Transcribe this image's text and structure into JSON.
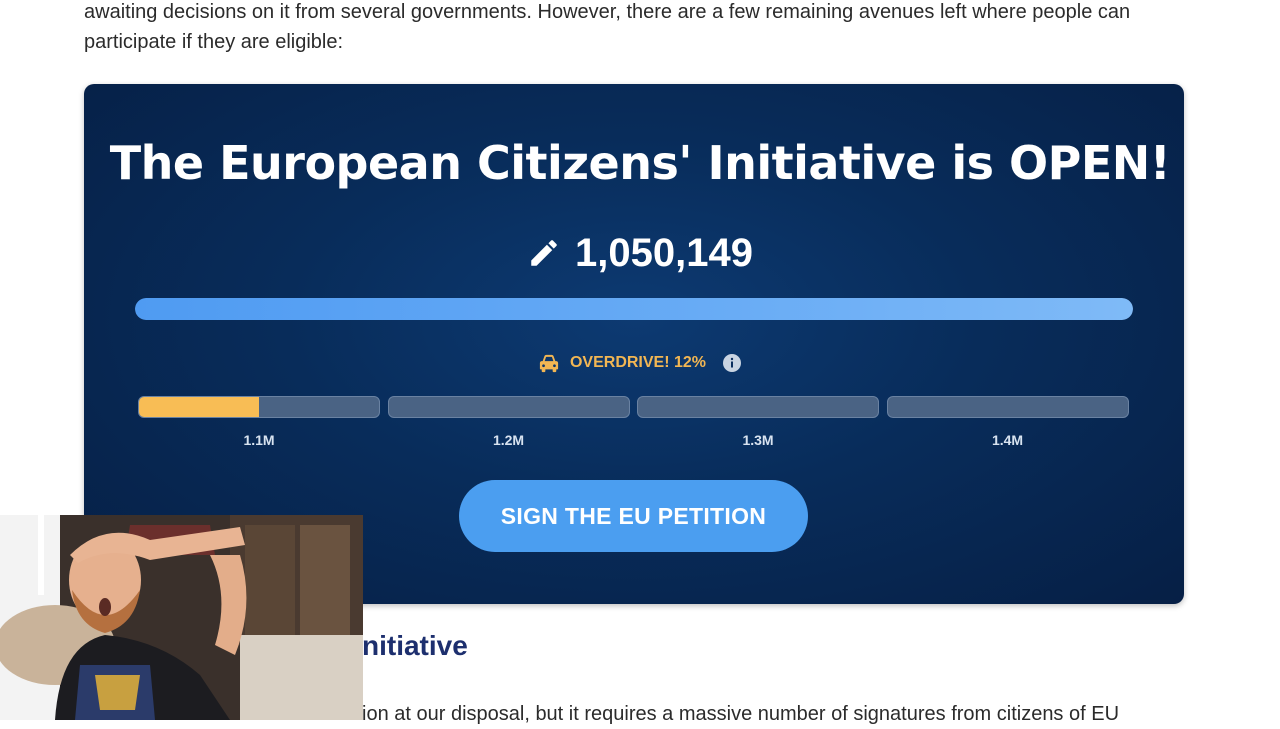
{
  "intro": {
    "line1": "awaiting decisions on it from several governments. However, there are a few remaining avenues left where people can",
    "line2": "participate if they are eligible:"
  },
  "card": {
    "title": "The European Citizens' Initiative is OPEN!",
    "count": "1,050,149",
    "count_icon": "pencil-icon",
    "main_progress_fraction": 1.0,
    "overdrive": {
      "icon": "car-icon",
      "label": "OVERDRIVE! 12%",
      "info_icon": "info-icon"
    },
    "segments": [
      {
        "label": "1.1M",
        "fill_fraction": 0.5
      },
      {
        "label": "1.2M",
        "fill_fraction": 0
      },
      {
        "label": "1.3M",
        "fill_fraction": 0
      },
      {
        "label": "1.4M",
        "fill_fraction": 0
      }
    ],
    "button_label": "SIGN THE EU PETITION"
  },
  "section": {
    "heading": "nitiative",
    "body": "ion at our disposal, but it requires a massive number of signatures from citizens of EU"
  },
  "colors": {
    "card_bg": "#082c5a",
    "progress_blue": "#4f9bf2",
    "overdrive_gold": "#f2b653",
    "segment_fill": "#f8bd55",
    "button_blue": "#4b9ef0",
    "heading_navy": "#1d2f6e"
  }
}
